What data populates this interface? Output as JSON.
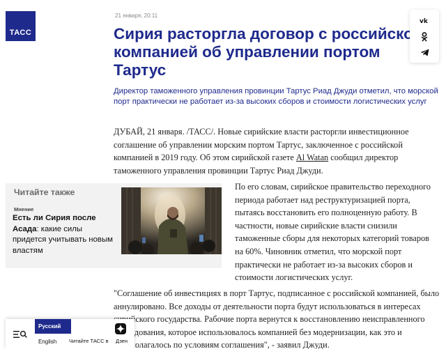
{
  "header": {
    "logo_text": "ТАСС",
    "date": "21 января, 20:11"
  },
  "share": {
    "vk_label": "vk",
    "ok_label": "ok",
    "tg_label": "tg"
  },
  "article": {
    "title": "Сирия расторгла договор с российской компанией об управлении портом Тартус",
    "lead": "Директор таможенного управления провинции Тартус Риад Джуди отметил, что морской порт практически не работает из-за высоких сборов и стоимости логистических услуг",
    "p1_before_link": "ДУБАЙ, 21 января. /ТАСС/. Новые сирийские власти расторгли инвестиционное соглашение об управлении морским портом Тартус, заключенное с российской компанией в 2019 году. Об этом сирийской газете ",
    "p1_link": "Al Watan",
    "p1_after_link": " сообщил директор таможенного управления провинции Тартус Риад Джуди.",
    "p2": "По его словам, сирийское правительство переходного периода работает над реструктуризацией порта, пытаясь восстановить его полноценную работу. В частности, новые сирийские власти снизили таможенные сборы для некоторых категорий товаров на 60%. Чиновник отметил, что морской порт практически не работает из-за высоких сборов и стоимости логистических услуг.",
    "p3": "\"Соглашение об инвестициях в порт Тартус, подписанное с российской компанией, было аннулировано. Все доходы от деятельности порта будут использоваться в интересах сирийского государства. Рабочие порта вернутся к восстановлению неисправленного оборудования, которое использовалось компанией без модернизации, как это и предполагалось по условиям соглашения\", - заявил Джуди."
  },
  "read_also": {
    "heading": "Читайте также",
    "tag": "Мнение",
    "title_bold": "Есть ли Сирия после Асада",
    "title_rest": ": какие силы придется учитывать новым властям"
  },
  "bottombar": {
    "lang_active": "Русский",
    "lang_other": "English",
    "read_tass": "Читайте ТАСС в",
    "dzen": "Дзен"
  },
  "colors": {
    "brand": "#1e2a8c",
    "panel_bg": "#f2f2f2"
  },
  "icons": [
    "tass-logo",
    "vk-icon",
    "ok-icon",
    "telegram-icon",
    "menu-search-icon",
    "dzen-icon"
  ]
}
